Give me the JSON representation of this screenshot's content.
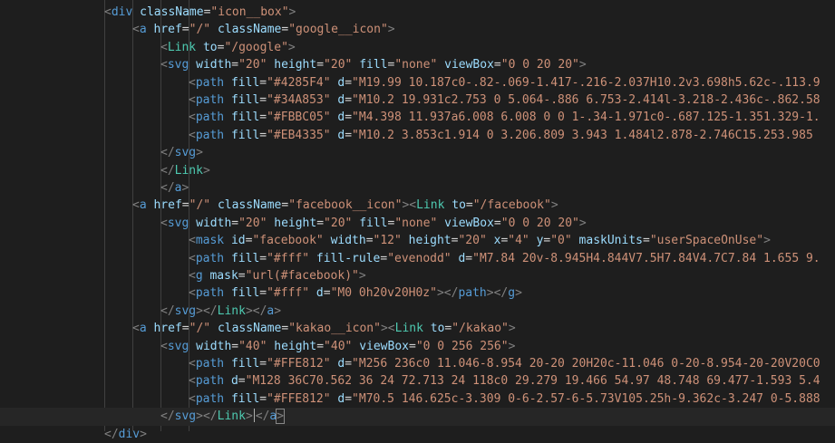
{
  "editor": {
    "background": "#1e1e1e",
    "active_line": 23,
    "lines": [
      {
        "indent": 4,
        "tokens": [
          [
            "p",
            "<"
          ],
          [
            "tag",
            "div"
          ],
          [
            "text",
            " "
          ],
          [
            "attr",
            "className"
          ],
          [
            "text",
            "="
          ],
          [
            "str",
            "\"icon__box\""
          ],
          [
            "p",
            ">"
          ]
        ]
      },
      {
        "indent": 5,
        "tokens": [
          [
            "p",
            "<"
          ],
          [
            "tag",
            "a"
          ],
          [
            "text",
            " "
          ],
          [
            "attr",
            "href"
          ],
          [
            "text",
            "="
          ],
          [
            "str",
            "\"/\""
          ],
          [
            "text",
            " "
          ],
          [
            "attr",
            "className"
          ],
          [
            "text",
            "="
          ],
          [
            "str",
            "\"google__icon\""
          ],
          [
            "p",
            ">"
          ]
        ]
      },
      {
        "indent": 6,
        "tokens": [
          [
            "p",
            "<"
          ],
          [
            "comp",
            "Link"
          ],
          [
            "text",
            " "
          ],
          [
            "attr",
            "to"
          ],
          [
            "text",
            "="
          ],
          [
            "str",
            "\"/google\""
          ],
          [
            "p",
            ">"
          ]
        ]
      },
      {
        "indent": 6,
        "tokens": [
          [
            "p",
            "<"
          ],
          [
            "tag",
            "svg"
          ],
          [
            "text",
            " "
          ],
          [
            "attr",
            "width"
          ],
          [
            "text",
            "="
          ],
          [
            "str",
            "\"20\""
          ],
          [
            "text",
            " "
          ],
          [
            "attr",
            "height"
          ],
          [
            "text",
            "="
          ],
          [
            "str",
            "\"20\""
          ],
          [
            "text",
            " "
          ],
          [
            "attr",
            "fill"
          ],
          [
            "text",
            "="
          ],
          [
            "str",
            "\"none\""
          ],
          [
            "text",
            " "
          ],
          [
            "attr",
            "viewBox"
          ],
          [
            "text",
            "="
          ],
          [
            "str",
            "\"0 0 20 20\""
          ],
          [
            "p",
            ">"
          ]
        ]
      },
      {
        "indent": 7,
        "tokens": [
          [
            "p",
            "<"
          ],
          [
            "tag",
            "path"
          ],
          [
            "text",
            " "
          ],
          [
            "attr",
            "fill"
          ],
          [
            "text",
            "="
          ],
          [
            "str",
            "\"#4285F4\""
          ],
          [
            "text",
            " "
          ],
          [
            "attr",
            "d"
          ],
          [
            "text",
            "="
          ],
          [
            "str",
            "\"M19.99 10.187c0-.82-.069-1.417-.216-2.037H10.2v3.698h5.62c-.113.9"
          ]
        ]
      },
      {
        "indent": 7,
        "tokens": [
          [
            "p",
            "<"
          ],
          [
            "tag",
            "path"
          ],
          [
            "text",
            " "
          ],
          [
            "attr",
            "fill"
          ],
          [
            "text",
            "="
          ],
          [
            "str",
            "\"#34A853\""
          ],
          [
            "text",
            " "
          ],
          [
            "attr",
            "d"
          ],
          [
            "text",
            "="
          ],
          [
            "str",
            "\"M10.2 19.931c2.753 0 5.064-.886 6.753-2.414l-3.218-2.436c-.862.58"
          ]
        ]
      },
      {
        "indent": 7,
        "tokens": [
          [
            "p",
            "<"
          ],
          [
            "tag",
            "path"
          ],
          [
            "text",
            " "
          ],
          [
            "attr",
            "fill"
          ],
          [
            "text",
            "="
          ],
          [
            "str",
            "\"#FBBC05\""
          ],
          [
            "text",
            " "
          ],
          [
            "attr",
            "d"
          ],
          [
            "text",
            "="
          ],
          [
            "str",
            "\"M4.398 11.937a6.008 6.008 0 0 1-.34-1.971c0-.687.125-1.351.329-1."
          ]
        ]
      },
      {
        "indent": 7,
        "tokens": [
          [
            "p",
            "<"
          ],
          [
            "tag",
            "path"
          ],
          [
            "text",
            " "
          ],
          [
            "attr",
            "fill"
          ],
          [
            "text",
            "="
          ],
          [
            "str",
            "\"#EB4335\""
          ],
          [
            "text",
            " "
          ],
          [
            "attr",
            "d"
          ],
          [
            "text",
            "="
          ],
          [
            "str",
            "\"M10.2 3.853c1.914 0 3.206.809 3.943 1.484l2.878-2.746C15.253.985"
          ]
        ]
      },
      {
        "indent": 6,
        "tokens": [
          [
            "p",
            "</"
          ],
          [
            "tag",
            "svg"
          ],
          [
            "p",
            ">"
          ]
        ]
      },
      {
        "indent": 6,
        "tokens": [
          [
            "p",
            "</"
          ],
          [
            "comp",
            "Link"
          ],
          [
            "p",
            ">"
          ]
        ]
      },
      {
        "indent": 6,
        "tokens": [
          [
            "p",
            "</"
          ],
          [
            "tag",
            "a"
          ],
          [
            "p",
            ">"
          ]
        ]
      },
      {
        "indent": 5,
        "tokens": [
          [
            "p",
            "<"
          ],
          [
            "tag",
            "a"
          ],
          [
            "text",
            " "
          ],
          [
            "attr",
            "href"
          ],
          [
            "text",
            "="
          ],
          [
            "str",
            "\"/\""
          ],
          [
            "text",
            " "
          ],
          [
            "attr",
            "className"
          ],
          [
            "text",
            "="
          ],
          [
            "str",
            "\"facebook__icon\""
          ],
          [
            "p",
            ">"
          ],
          [
            "p",
            "<"
          ],
          [
            "comp",
            "Link"
          ],
          [
            "text",
            " "
          ],
          [
            "attr",
            "to"
          ],
          [
            "text",
            "="
          ],
          [
            "str",
            "\"/facebook\""
          ],
          [
            "p",
            ">"
          ]
        ]
      },
      {
        "indent": 6,
        "tokens": [
          [
            "p",
            "<"
          ],
          [
            "tag",
            "svg"
          ],
          [
            "text",
            " "
          ],
          [
            "attr",
            "width"
          ],
          [
            "text",
            "="
          ],
          [
            "str",
            "\"20\""
          ],
          [
            "text",
            " "
          ],
          [
            "attr",
            "height"
          ],
          [
            "text",
            "="
          ],
          [
            "str",
            "\"20\""
          ],
          [
            "text",
            " "
          ],
          [
            "attr",
            "fill"
          ],
          [
            "text",
            "="
          ],
          [
            "str",
            "\"none\""
          ],
          [
            "text",
            " "
          ],
          [
            "attr",
            "viewBox"
          ],
          [
            "text",
            "="
          ],
          [
            "str",
            "\"0 0 20 20\""
          ],
          [
            "p",
            ">"
          ]
        ]
      },
      {
        "indent": 7,
        "tokens": [
          [
            "p",
            "<"
          ],
          [
            "tag",
            "mask"
          ],
          [
            "text",
            " "
          ],
          [
            "attr",
            "id"
          ],
          [
            "text",
            "="
          ],
          [
            "str",
            "\"facebook\""
          ],
          [
            "text",
            " "
          ],
          [
            "attr",
            "width"
          ],
          [
            "text",
            "="
          ],
          [
            "str",
            "\"12\""
          ],
          [
            "text",
            " "
          ],
          [
            "attr",
            "height"
          ],
          [
            "text",
            "="
          ],
          [
            "str",
            "\"20\""
          ],
          [
            "text",
            " "
          ],
          [
            "attr",
            "x"
          ],
          [
            "text",
            "="
          ],
          [
            "str",
            "\"4\""
          ],
          [
            "text",
            " "
          ],
          [
            "attr",
            "y"
          ],
          [
            "text",
            "="
          ],
          [
            "str",
            "\"0\""
          ],
          [
            "text",
            " "
          ],
          [
            "attr",
            "maskUnits"
          ],
          [
            "text",
            "="
          ],
          [
            "str",
            "\"userSpaceOnUse\""
          ],
          [
            "p",
            ">"
          ]
        ]
      },
      {
        "indent": 7,
        "tokens": [
          [
            "p",
            "<"
          ],
          [
            "tag",
            "path"
          ],
          [
            "text",
            " "
          ],
          [
            "attr",
            "fill"
          ],
          [
            "text",
            "="
          ],
          [
            "str",
            "\"#fff\""
          ],
          [
            "text",
            " "
          ],
          [
            "attr",
            "fill-rule"
          ],
          [
            "text",
            "="
          ],
          [
            "str",
            "\"evenodd\""
          ],
          [
            "text",
            " "
          ],
          [
            "attr",
            "d"
          ],
          [
            "text",
            "="
          ],
          [
            "str",
            "\"M7.84 20v-8.945H4.844V7.5H7.84V4.7C7.84 1.655 9."
          ]
        ]
      },
      {
        "indent": 7,
        "tokens": [
          [
            "p",
            "<"
          ],
          [
            "tag",
            "g"
          ],
          [
            "text",
            " "
          ],
          [
            "attr",
            "mask"
          ],
          [
            "text",
            "="
          ],
          [
            "str",
            "\"url(#facebook)\""
          ],
          [
            "p",
            ">"
          ]
        ]
      },
      {
        "indent": 7,
        "tokens": [
          [
            "p",
            "<"
          ],
          [
            "tag",
            "path"
          ],
          [
            "text",
            " "
          ],
          [
            "attr",
            "fill"
          ],
          [
            "text",
            "="
          ],
          [
            "str",
            "\"#fff\""
          ],
          [
            "text",
            " "
          ],
          [
            "attr",
            "d"
          ],
          [
            "text",
            "="
          ],
          [
            "str",
            "\"M0 0h20v20H0z\""
          ],
          [
            "p",
            ">"
          ],
          [
            "p",
            "</"
          ],
          [
            "tag",
            "path"
          ],
          [
            "p",
            ">"
          ],
          [
            "p",
            "</"
          ],
          [
            "tag",
            "g"
          ],
          [
            "p",
            ">"
          ]
        ]
      },
      {
        "indent": 6,
        "tokens": [
          [
            "p",
            "</"
          ],
          [
            "tag",
            "svg"
          ],
          [
            "p",
            ">"
          ],
          [
            "p",
            "</"
          ],
          [
            "comp",
            "Link"
          ],
          [
            "p",
            ">"
          ],
          [
            "p",
            "</"
          ],
          [
            "tag",
            "a"
          ],
          [
            "p",
            ">"
          ]
        ]
      },
      {
        "indent": 5,
        "tokens": [
          [
            "p",
            "<"
          ],
          [
            "tag",
            "a"
          ],
          [
            "text",
            " "
          ],
          [
            "attr",
            "href"
          ],
          [
            "text",
            "="
          ],
          [
            "str",
            "\"/\""
          ],
          [
            "text",
            " "
          ],
          [
            "attr",
            "className"
          ],
          [
            "text",
            "="
          ],
          [
            "str",
            "\"kakao__icon\""
          ],
          [
            "p",
            ">"
          ],
          [
            "p",
            "<"
          ],
          [
            "comp",
            "Link"
          ],
          [
            "text",
            " "
          ],
          [
            "attr",
            "to"
          ],
          [
            "text",
            "="
          ],
          [
            "str",
            "\"/kakao\""
          ],
          [
            "p",
            ">"
          ]
        ]
      },
      {
        "indent": 6,
        "tokens": [
          [
            "p",
            "<"
          ],
          [
            "tag",
            "svg"
          ],
          [
            "text",
            " "
          ],
          [
            "attr",
            "width"
          ],
          [
            "text",
            "="
          ],
          [
            "str",
            "\"40\""
          ],
          [
            "text",
            " "
          ],
          [
            "attr",
            "height"
          ],
          [
            "text",
            "="
          ],
          [
            "str",
            "\"40\""
          ],
          [
            "text",
            " "
          ],
          [
            "attr",
            "viewBox"
          ],
          [
            "text",
            "="
          ],
          [
            "str",
            "\"0 0 256 256\""
          ],
          [
            "p",
            ">"
          ]
        ]
      },
      {
        "indent": 7,
        "tokens": [
          [
            "p",
            "<"
          ],
          [
            "tag",
            "path"
          ],
          [
            "text",
            " "
          ],
          [
            "attr",
            "fill"
          ],
          [
            "text",
            "="
          ],
          [
            "str",
            "\"#FFE812\""
          ],
          [
            "text",
            " "
          ],
          [
            "attr",
            "d"
          ],
          [
            "text",
            "="
          ],
          [
            "str",
            "\"M256 236c0 11.046-8.954 20-20 20H20c-11.046 0-20-8.954-20-20V20C0"
          ]
        ]
      },
      {
        "indent": 7,
        "tokens": [
          [
            "p",
            "<"
          ],
          [
            "tag",
            "path"
          ],
          [
            "text",
            " "
          ],
          [
            "attr",
            "d"
          ],
          [
            "text",
            "="
          ],
          [
            "str",
            "\"M128 36C70.562 36 24 72.713 24 118c0 29.279 19.466 54.97 48.748 69.477-1.593 5.4"
          ]
        ]
      },
      {
        "indent": 7,
        "tokens": [
          [
            "p",
            "<"
          ],
          [
            "tag",
            "path"
          ],
          [
            "text",
            " "
          ],
          [
            "attr",
            "fill"
          ],
          [
            "text",
            "="
          ],
          [
            "str",
            "\"#FFE812\""
          ],
          [
            "text",
            " "
          ],
          [
            "attr",
            "d"
          ],
          [
            "text",
            "="
          ],
          [
            "str",
            "\"M70.5 146.625c-3.309 0-6-2.57-6-5.73V105.25h-9.362c-3.247 0-5.888"
          ]
        ]
      },
      {
        "indent": 6,
        "tokens": [
          [
            "p",
            "</"
          ],
          [
            "tag",
            "svg"
          ],
          [
            "p",
            ">"
          ],
          [
            "p",
            "</"
          ],
          [
            "comp",
            "Link"
          ],
          [
            "p",
            ">"
          ],
          [
            "caret",
            ""
          ],
          [
            "p",
            "</"
          ],
          [
            "tag",
            "a"
          ],
          [
            "bp",
            ">"
          ]
        ]
      },
      {
        "indent": 4,
        "tokens": [
          [
            "p",
            "</"
          ],
          [
            "tag",
            "div"
          ],
          [
            "p",
            ">"
          ]
        ]
      }
    ]
  }
}
